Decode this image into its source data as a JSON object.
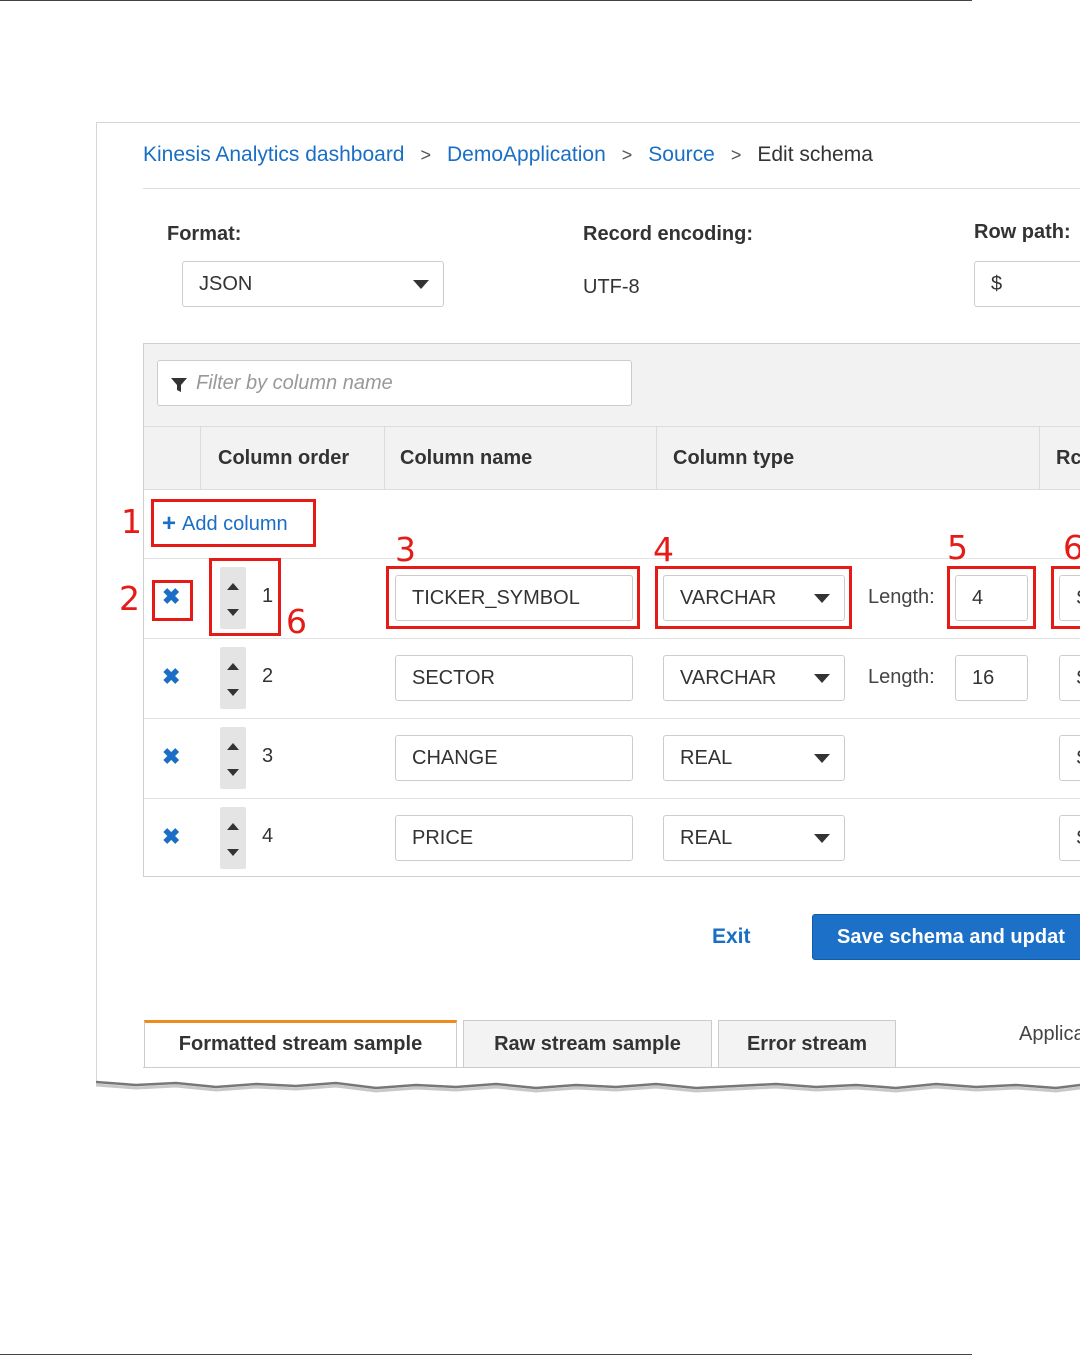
{
  "breadcrumb": {
    "items": [
      "Kinesis Analytics dashboard",
      "DemoApplication",
      "Source"
    ],
    "current": "Edit schema",
    "separator": ">"
  },
  "format": {
    "label": "Format:",
    "value": "JSON"
  },
  "record_encoding": {
    "label": "Record encoding:",
    "value": "UTF-8"
  },
  "row_path": {
    "label": "Row path:",
    "value": "$"
  },
  "filter": {
    "placeholder": "Filter by column name"
  },
  "table": {
    "headers": [
      "Column order",
      "Column name",
      "Column type",
      "Rc"
    ],
    "add_column_label": "Add column",
    "length_label": "Length:",
    "rows": [
      {
        "order": "1",
        "name": "TICKER_SYMBOL",
        "type": "VARCHAR",
        "length": "4",
        "extra": "S"
      },
      {
        "order": "2",
        "name": "SECTOR",
        "type": "VARCHAR",
        "length": "16",
        "extra": "S"
      },
      {
        "order": "3",
        "name": "CHANGE",
        "type": "REAL",
        "length": "",
        "extra": "S"
      },
      {
        "order": "4",
        "name": "PRICE",
        "type": "REAL",
        "length": "",
        "extra": "S"
      }
    ]
  },
  "annotations": [
    "1",
    "2",
    "3",
    "4",
    "5",
    "6",
    "6"
  ],
  "actions": {
    "exit": "Exit",
    "save": "Save schema and updat"
  },
  "tabs": [
    "Formatted stream sample",
    "Raw stream sample",
    "Error stream"
  ],
  "trailing_text": "Applica",
  "colors": {
    "link": "#1a6ec5",
    "annotation": "#e41b17",
    "primary": "#1c70c8",
    "tab_active": "#ee8b1e"
  }
}
